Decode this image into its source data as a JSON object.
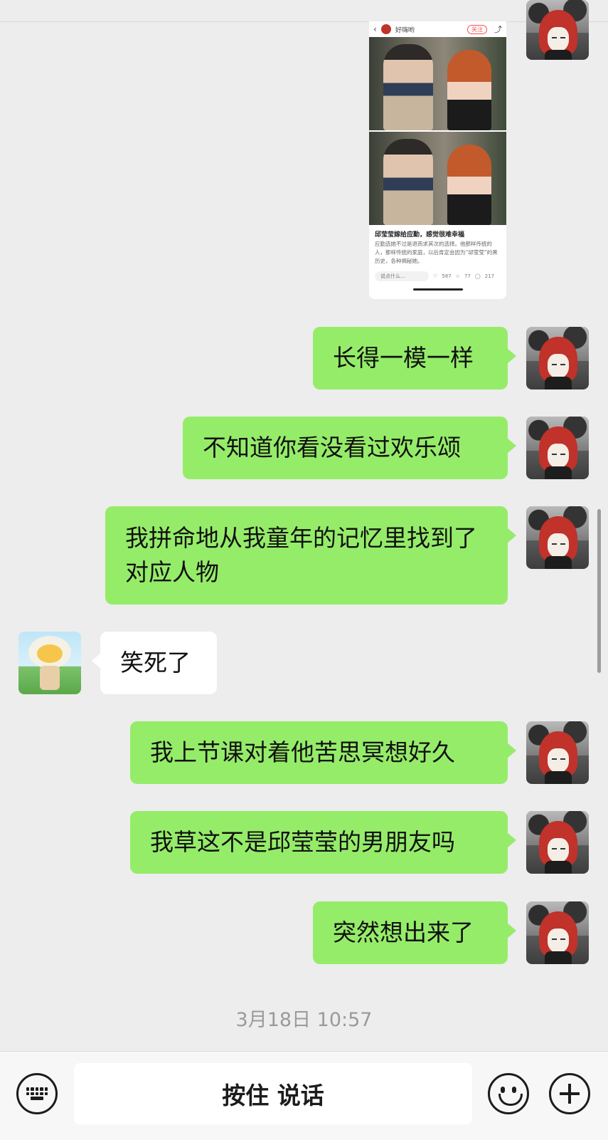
{
  "shared_card": {
    "author": "好嗨哟",
    "follow_label": "关注",
    "title": "邱莹莹嫁给应勤，感觉很难幸福",
    "text": "应勤选她不过是退而求其次的选择。他那样传统的人，那样传统的家庭，以后肯定会因为“邱莹莹”的黑历史，各种揭秘她。",
    "comment_placeholder": "说点什么...",
    "likes": "587",
    "stars": "77",
    "comments": "217"
  },
  "messages": [
    {
      "from": "me",
      "text": "长得一模一样"
    },
    {
      "from": "me",
      "text": "不知道你看没看过欢乐颂"
    },
    {
      "from": "me",
      "text": "我拼命地从我童年的记忆里找到了对应人物"
    },
    {
      "from": "them",
      "text": "笑死了"
    },
    {
      "from": "me",
      "text": "我上节课对着他苦思冥想好久"
    },
    {
      "from": "me",
      "text": "我草这不是邱莹莹的男朋友吗"
    },
    {
      "from": "me",
      "text": "突然想出来了"
    }
  ],
  "timestamp": "3月18日 10:57",
  "input_bar": {
    "hold_to_talk_label": "按住 说话",
    "left_icon": "keyboard-icon",
    "emoji_icon": "emoji-icon",
    "plus_icon": "plus-icon"
  },
  "colors": {
    "my_bubble": "#95ec69",
    "their_bubble": "#ffffff",
    "background": "#ededed"
  }
}
